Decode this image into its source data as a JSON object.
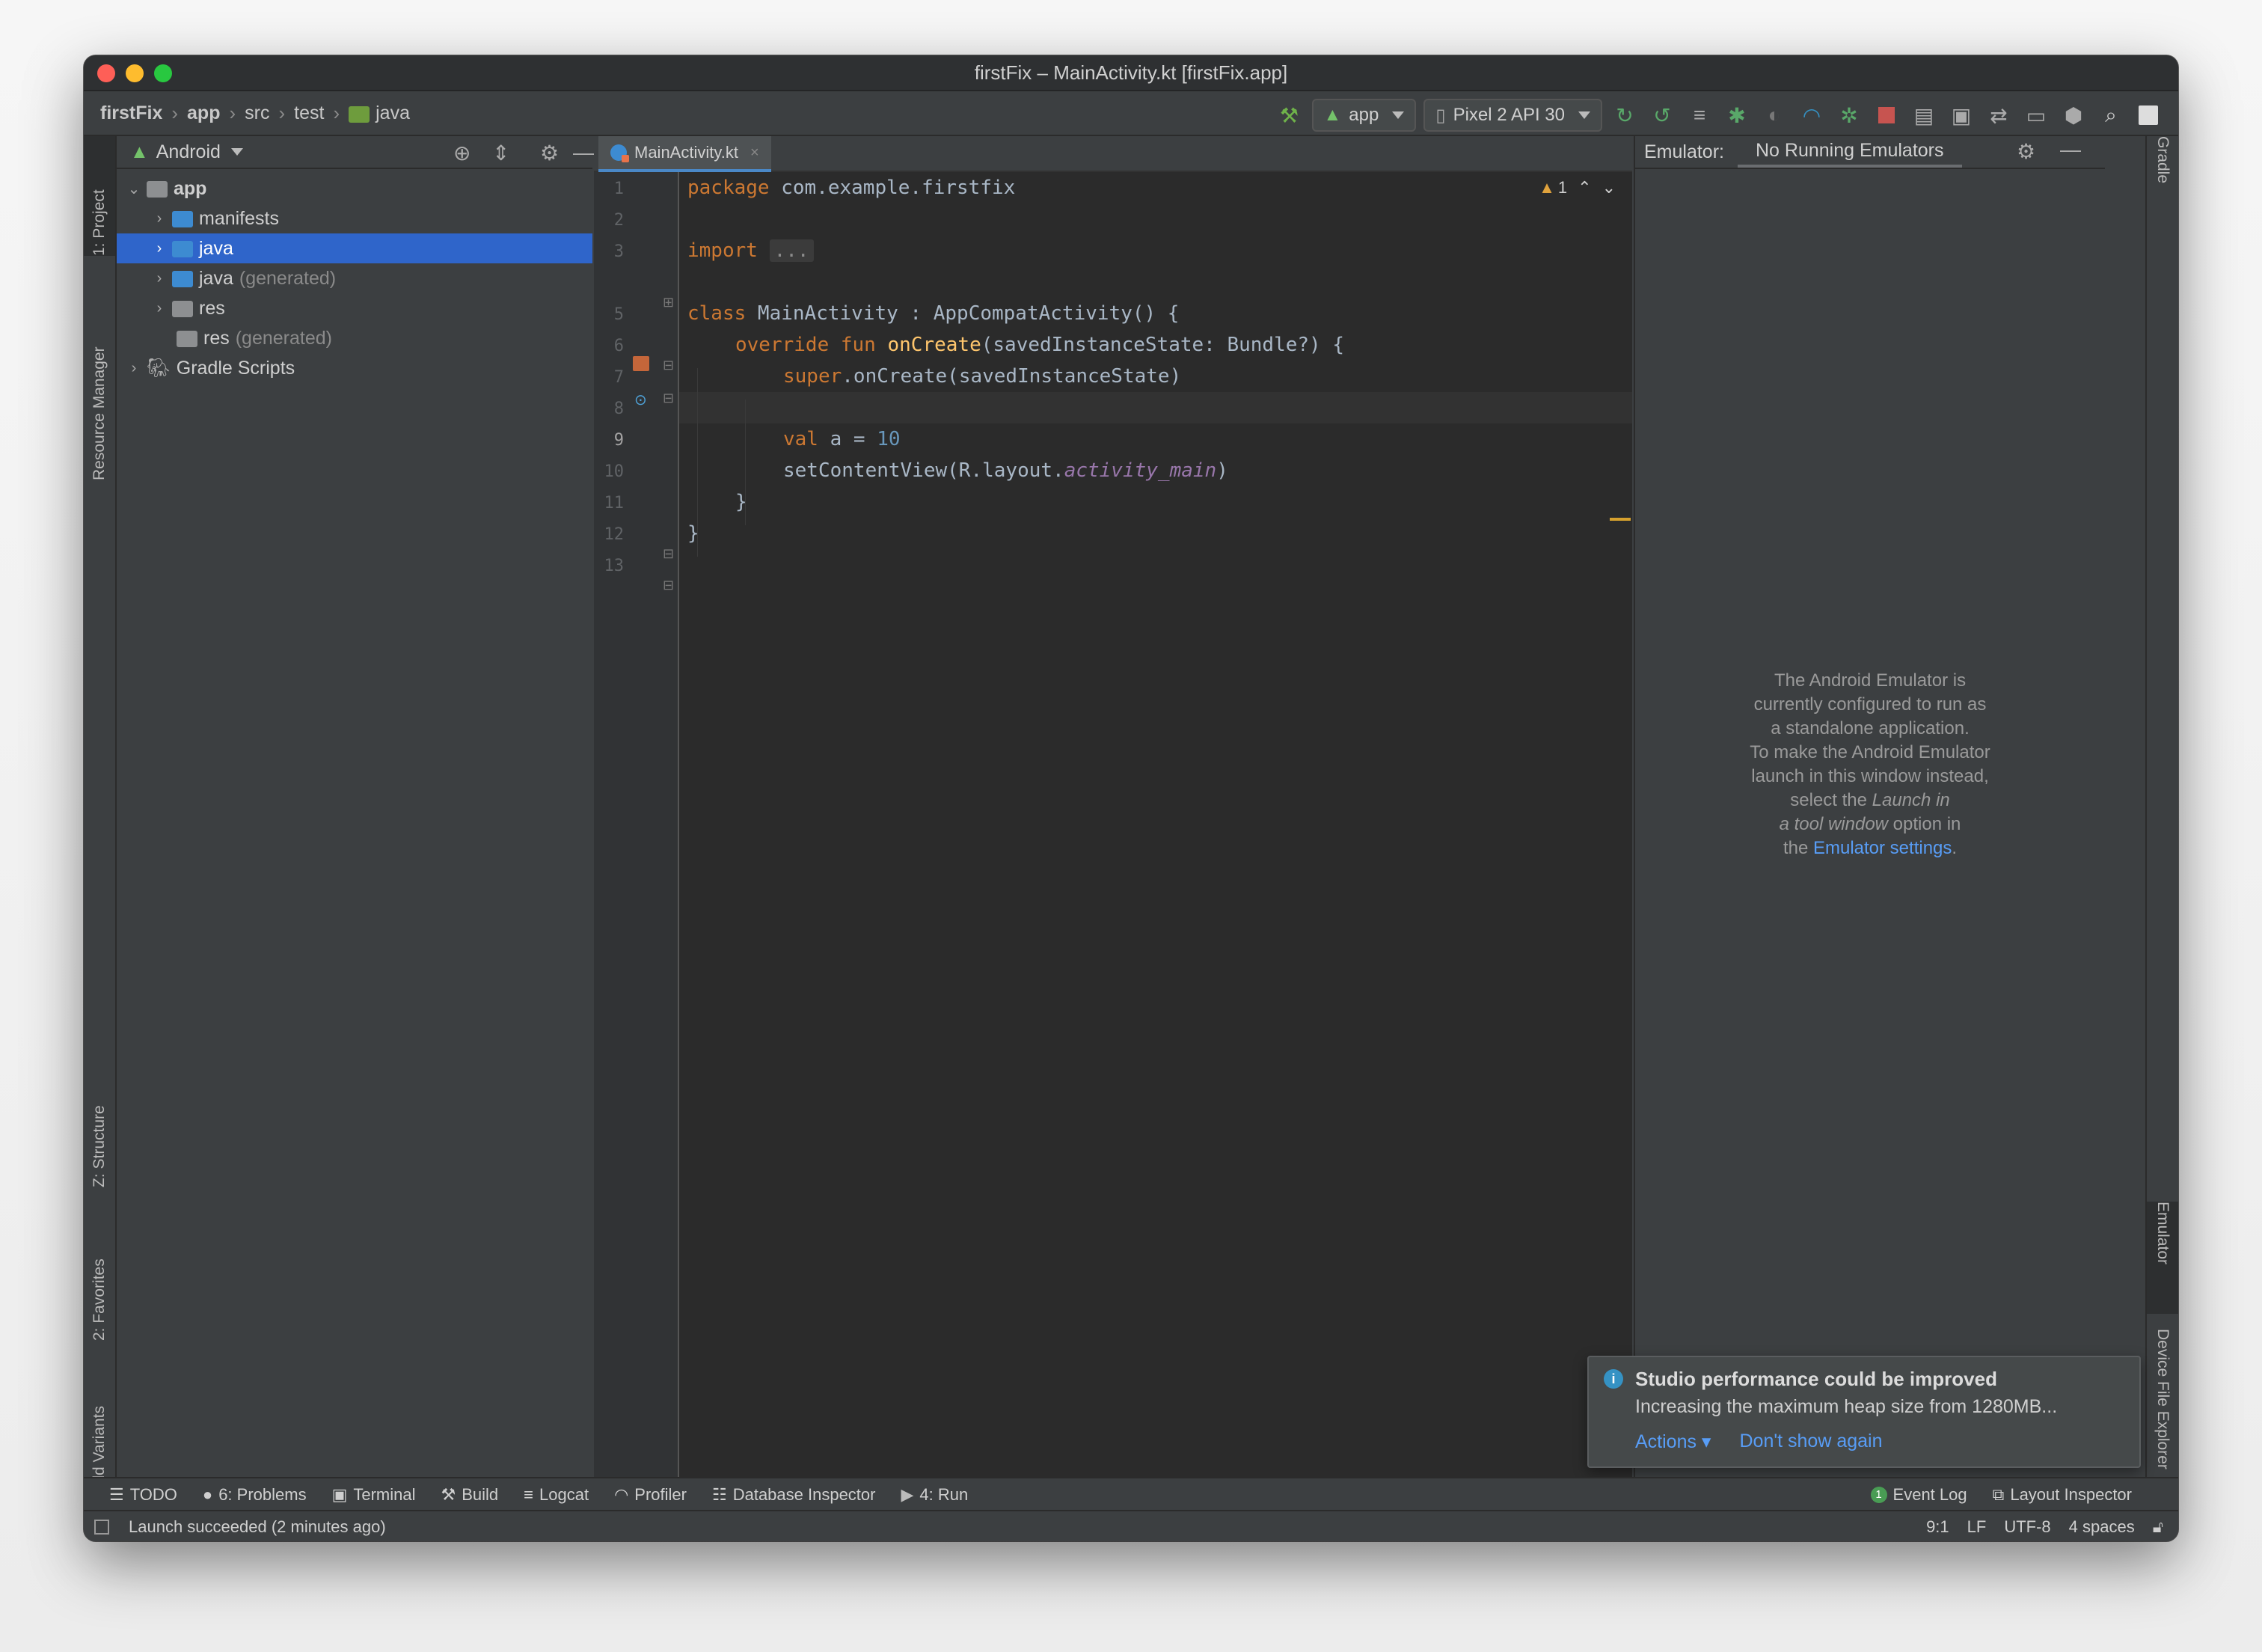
{
  "window": {
    "title": "firstFix – MainActivity.kt [firstFix.app]"
  },
  "breadcrumbs": [
    "firstFix",
    "app",
    "src",
    "test",
    "java"
  ],
  "toolbar": {
    "run_config": "app",
    "device": "Pixel 2 API 30",
    "icons": [
      "hammer-icon",
      "rerun-icon",
      "apply-changes-icon",
      "apply-code-icon",
      "debug-icon",
      "profile-icon",
      "attach-icon",
      "stop-icon",
      "sdk-manager-icon",
      "avd-icon",
      "sync-icon",
      "device-manager-icon",
      "search-icon",
      "account-icon"
    ]
  },
  "left_stripe": {
    "tabs": [
      "1: Project",
      "Resource Manager",
      "Z: Structure",
      "2: Favorites",
      "Build Variants"
    ]
  },
  "project": {
    "view": "Android",
    "tree": [
      {
        "label": "app",
        "type": "module"
      },
      {
        "label": "manifests",
        "type": "folder"
      },
      {
        "label": "java",
        "type": "folder",
        "selected": true
      },
      {
        "label": "java",
        "suffix": "(generated)",
        "type": "folder"
      },
      {
        "label": "res",
        "type": "folder"
      },
      {
        "label": "res",
        "suffix": "(generated)",
        "type": "folder"
      },
      {
        "label": "Gradle Scripts",
        "type": "gradle"
      }
    ]
  },
  "editor": {
    "tab": "MainActivity.kt",
    "warning_count": "1",
    "line_numbers": [
      "1",
      "2",
      "3",
      "5",
      "6",
      "7",
      "8",
      "9",
      "10",
      "11",
      "12",
      "13"
    ],
    "code": {
      "l1_kw": "package",
      "l1_rest": " com.example.firstfix",
      "l3_kw": "import",
      "l3_fold": "...",
      "l6_kw": "class",
      "l6_rest": " MainActivity : AppCompatActivity() {",
      "l7_kw": "override fun",
      "l7_fn": "onCreate",
      "l7_rest": "(savedInstanceState: Bundle?) {",
      "l8_kw": "super",
      "l8_rest": ".onCreate(savedInstanceState)",
      "l10_kw": "val",
      "l10_rest": " a = ",
      "l10_num": "10",
      "l11_rest": "setContentView(R.layout.",
      "l11_it": "activity_main",
      "l11_end": ")",
      "l12": "}",
      "l13": "}"
    }
  },
  "emulator": {
    "label": "Emulator:",
    "tab": "No Running Emulators",
    "message_lines": [
      "The Android Emulator is",
      "currently configured to run as",
      "a standalone application.",
      "To make the Android Emulator",
      "launch in this window instead,"
    ],
    "msg_select": "select the ",
    "msg_launch_in": "Launch in",
    "msg_tool_window": "a tool window",
    "msg_option_in": " option in",
    "msg_the": "the ",
    "msg_link": "Emulator settings",
    "msg_period": "."
  },
  "right_stripe": {
    "tabs": [
      "Gradle",
      "Emulator",
      "Device File Explorer"
    ]
  },
  "notification": {
    "title": "Studio performance could be improved",
    "message": "Increasing the maximum heap size from 1280MB...",
    "action_1": "Actions",
    "action_2": "Don't show again"
  },
  "bottom_tools": [
    {
      "label": "TODO",
      "icon": "list-icon"
    },
    {
      "label": "6: Problems",
      "icon": "problems-icon"
    },
    {
      "label": "Terminal",
      "icon": "terminal-icon"
    },
    {
      "label": "Build",
      "icon": "hammer-icon"
    },
    {
      "label": "Logcat",
      "icon": "logcat-icon"
    },
    {
      "label": "Profiler",
      "icon": "profiler-icon"
    },
    {
      "label": "Database Inspector",
      "icon": "database-icon"
    },
    {
      "label": "4: Run",
      "icon": "run-icon"
    }
  ],
  "bottom_right_tools": [
    {
      "label": "Event Log",
      "badge": "1"
    },
    {
      "label": "Layout Inspector"
    }
  ],
  "status": {
    "message": "Launch succeeded (2 minutes ago)",
    "position": "9:1",
    "line_sep": "LF",
    "encoding": "UTF-8",
    "indent": "4 spaces"
  },
  "colors": {
    "keyword": "#cc7832",
    "function": "#ffc66d",
    "number": "#6897bb",
    "italic_ref": "#9876aa",
    "selection": "#2f65ca",
    "link": "#589df6"
  }
}
